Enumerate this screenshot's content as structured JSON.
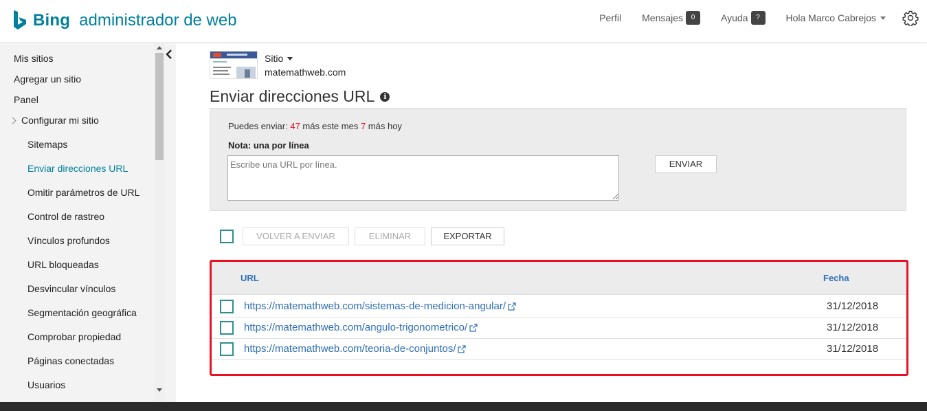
{
  "header": {
    "brand": "Bing",
    "product": "administrador de web",
    "nav": {
      "profile": "Perfil",
      "messages": "Mensajes",
      "messages_count": "0",
      "help": "Ayuda",
      "help_badge": "?",
      "user": "Hola Marco Cabrejos"
    },
    "icons": {
      "settings": "gear-icon",
      "logo": "bing-logo-icon"
    },
    "brand_color": "#00809d"
  },
  "sidebar": {
    "items": [
      {
        "label": "Mis sitios"
      },
      {
        "label": "Agregar un sitio"
      },
      {
        "label": "Panel"
      },
      {
        "label": "Configurar mi sitio"
      },
      {
        "label": "Sitemaps"
      },
      {
        "label": "Enviar direcciones URL"
      },
      {
        "label": "Omitir parámetros de URL"
      },
      {
        "label": "Control de rastreo"
      },
      {
        "label": "Vínculos profundos"
      },
      {
        "label": "URL bloqueadas"
      },
      {
        "label": "Desvincular vínculos"
      },
      {
        "label": "Segmentación geográfica"
      },
      {
        "label": "Comprobar propiedad"
      },
      {
        "label": "Páginas conectadas"
      },
      {
        "label": "Usuarios"
      }
    ],
    "active": "Enviar direcciones URL"
  },
  "site": {
    "selector_label": "Sitio",
    "domain": "matemathweb.com"
  },
  "page": {
    "title": "Enviar direcciones URL",
    "info_icon": "i"
  },
  "submit": {
    "quota_prefix": "Puedes enviar: ",
    "month_count": "47",
    "month_suffix": " más este mes ",
    "day_count": "7",
    "day_suffix": " más hoy",
    "note": "Nota: una por línea",
    "placeholder": "Escribe una URL por línea.",
    "send_label": "ENVIAR"
  },
  "toolbar": {
    "resend_label": "VOLVER A ENVIAR",
    "delete_label": "ELIMINAR",
    "export_label": "EXPORTAR"
  },
  "table": {
    "columns": {
      "url": "URL",
      "date": "Fecha"
    },
    "rows": [
      {
        "url": "https://matemathweb.com/sistemas-de-medicion-angular/",
        "date": "31/12/2018"
      },
      {
        "url": "https://matemathweb.com/angulo-trigonometrico/",
        "date": "31/12/2018"
      },
      {
        "url": "https://matemathweb.com/teoria-de-conjuntos/",
        "date": "31/12/2018"
      }
    ]
  },
  "colors": {
    "highlight_border": "#e81123",
    "link": "#2e6fb7",
    "checkbox": "#2f8f8f"
  }
}
